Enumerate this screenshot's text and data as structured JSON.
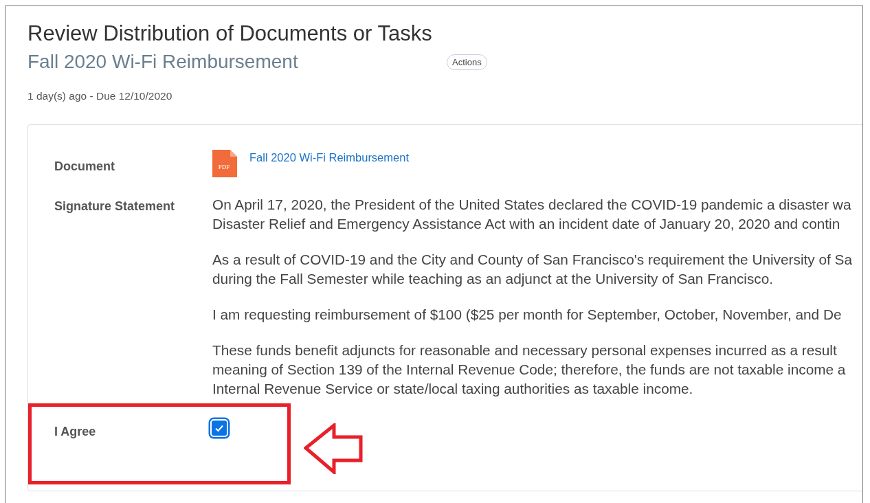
{
  "page": {
    "title": "Review Distribution of Documents or Tasks",
    "subtitle": "Fall 2020 Wi-Fi Reimbursement",
    "actions_button": "Actions",
    "meta": "1 day(s) ago - Due 12/10/2020"
  },
  "fields": [
    {
      "kind": "document",
      "label": "Document",
      "link": "Fall 2020 Wi-Fi Reimbursement",
      "file_icon": "PDF"
    },
    {
      "kind": "statement",
      "label": "Signature Statement",
      "paragraphs": [
        [
          "On April 17, 2020, the President of the United States declared the COVID-19 pandemic a disaster wa",
          "Disaster Relief and Emergency Assistance Act with an incident date of January 20, 2020 and contin"
        ],
        [
          "As a result of COVID-19 and the City and County of San Francisco's requirement the University of Sa",
          "during the Fall Semester while teaching as an adjunct at the University of San Francisco."
        ],
        [
          "I am requesting reimbursement of $100 ($25 per month for September, October, November, and De"
        ],
        [
          "These funds benefit adjuncts for reasonable and necessary personal expenses incurred as a result",
          "meaning of Section 139 of the Internal Revenue Code; therefore, the funds are not taxable income a",
          "Internal Revenue Service or state/local taxing authorities as taxable income."
        ]
      ]
    },
    {
      "kind": "checkbox",
      "label": "I Agree",
      "checked": true
    }
  ]
}
